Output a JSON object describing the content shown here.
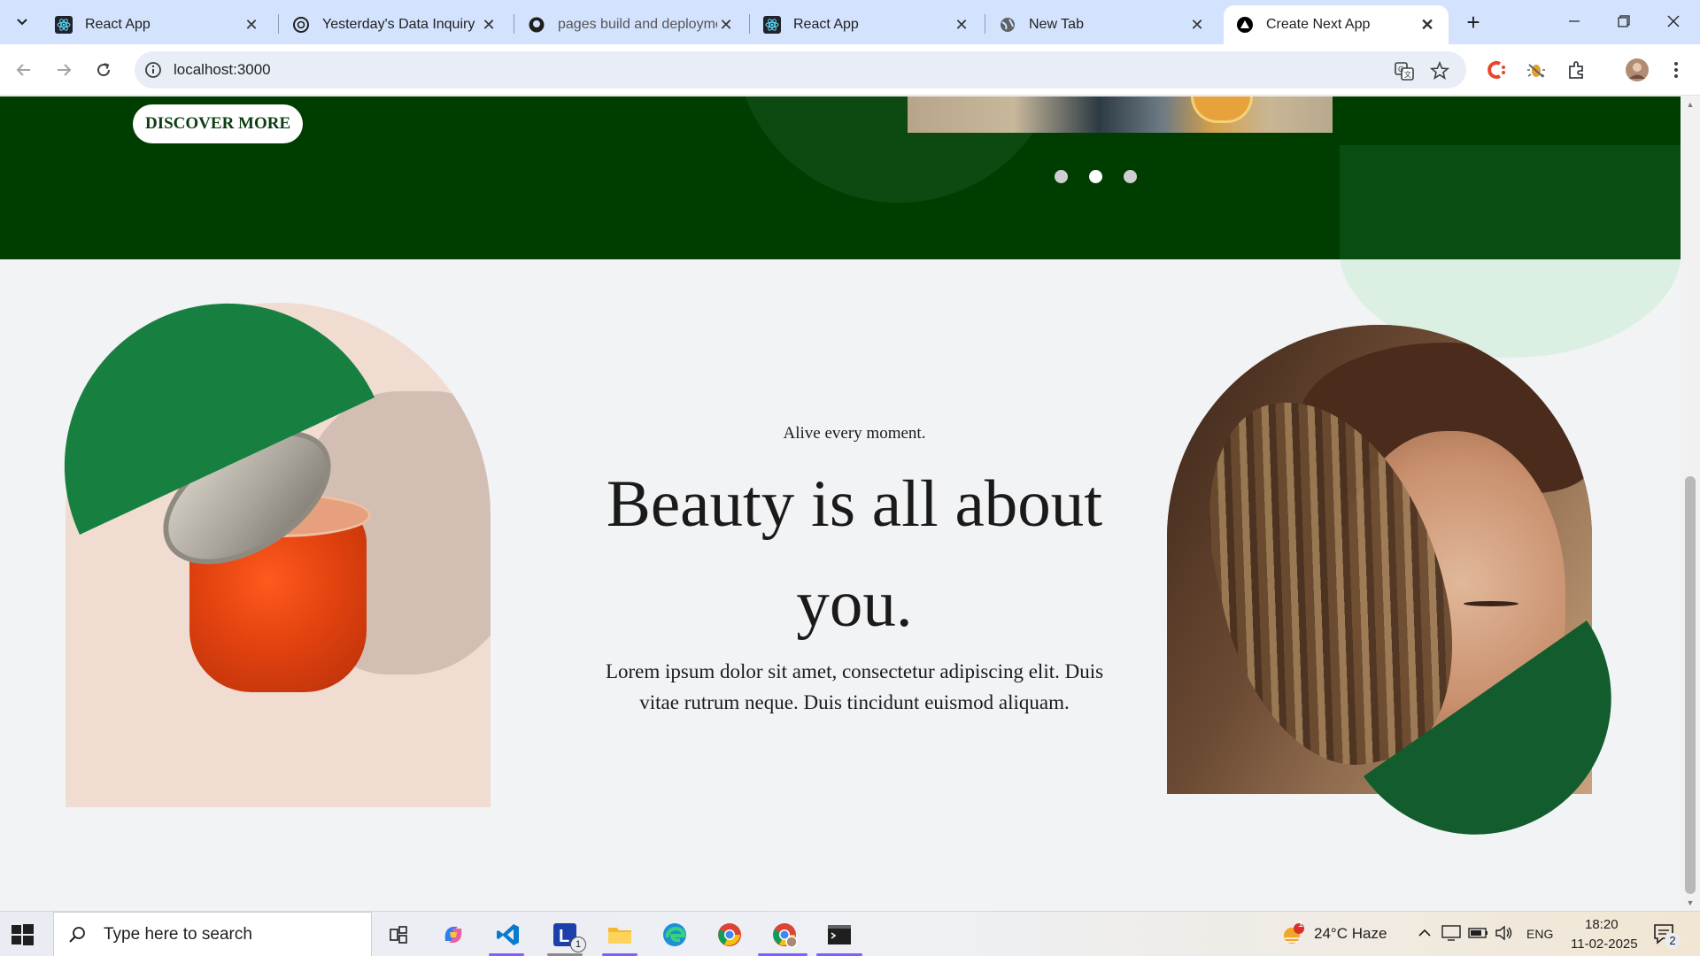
{
  "browser": {
    "tabs": [
      {
        "title": "React App",
        "icon": "react-icon",
        "active": false
      },
      {
        "title": "Yesterday's Data Inquiry",
        "icon": "openai-icon",
        "active": false
      },
      {
        "title": "pages build and deployme",
        "icon": "github-icon",
        "active": false
      },
      {
        "title": "React App",
        "icon": "react-icon",
        "active": false
      },
      {
        "title": "New Tab",
        "icon": "globe-icon",
        "active": false
      },
      {
        "title": "Create Next App",
        "icon": "nextjs-icon",
        "active": true
      }
    ],
    "new_tab_label": "+",
    "url": "localhost:3000"
  },
  "page": {
    "hero": {
      "button_label": "DISCOVER MORE",
      "carousel_dots": 3,
      "active_dot": 2
    },
    "section": {
      "tagline": "Alive every moment.",
      "headline_line1": "Beauty is all about",
      "headline_line2": "you.",
      "description_line1": "Lorem ipsum dolor sit amet, consectetur adipiscing elit. Duis",
      "description_line2": "vitae rutrum neque. Duis tincidunt euismod aliquam."
    },
    "colors": {
      "hero_green": "#003d00",
      "accent_green": "#178040",
      "dark_green": "#125c2e",
      "mint": "#dcefe3",
      "page_bg": "#f2f3f5"
    }
  },
  "taskbar": {
    "search_placeholder": "Type here to search",
    "weather": "24°C  Haze",
    "weather_badge": "1",
    "language": "ENG",
    "time": "18:20",
    "date": "11-02-2025",
    "notification_count": "2",
    "lens_badge": "1"
  }
}
